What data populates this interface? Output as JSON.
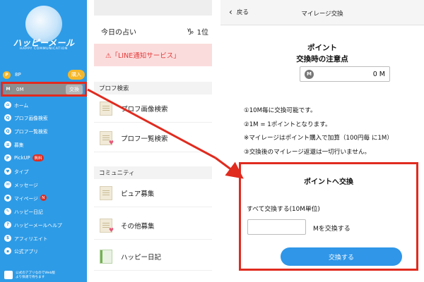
{
  "sidebar": {
    "logo_text": "ハッピーメール",
    "logo_sub": "HAPPY COMMUNICATION",
    "points": {
      "icon": "P",
      "value": "8P",
      "action": "購入"
    },
    "mileage": {
      "icon": "M",
      "value": "0M",
      "action": "交換"
    },
    "menu": [
      {
        "label": "ホーム",
        "icon": "home-icon",
        "glyph": "⌂"
      },
      {
        "label": "プロフ画像検索",
        "icon": "search-icon",
        "glyph": "Q"
      },
      {
        "label": "プロフ一覧検索",
        "icon": "search-icon",
        "glyph": "Q"
      },
      {
        "label": "募集",
        "icon": "list-icon",
        "glyph": "≡"
      },
      {
        "label": "PickUP",
        "icon": "pickup-icon",
        "glyph": "P",
        "badge": "無料"
      },
      {
        "label": "タイプ",
        "icon": "heart-icon",
        "glyph": "♥"
      },
      {
        "label": "メッセージ",
        "icon": "message-icon",
        "glyph": "✉"
      },
      {
        "label": "マイページ",
        "icon": "user-icon",
        "glyph": "●",
        "badge_round": "N"
      },
      {
        "label": "ハッピー日記",
        "icon": "diary-icon",
        "glyph": "✎"
      },
      {
        "label": "ハッピーメールヘルプ",
        "icon": "help-icon",
        "glyph": "?"
      },
      {
        "label": "アフィリエイト",
        "icon": "dollar-icon",
        "glyph": "$"
      },
      {
        "label": "公式アプリ",
        "icon": "app-icon",
        "glyph": "▪"
      }
    ],
    "footer_line1": "公式のアプリなのでWeb版",
    "footer_line2": "より快適で待ちます"
  },
  "middle": {
    "fortune_label": "今日の占い",
    "fortune_sign": "♑",
    "fortune_rank": "1位",
    "banner": "⚠「LINE通知サービス」",
    "section_profile": "プロフ検索",
    "item_prof_image": "プロフ画像検索",
    "item_prof_list": "プロフ一覧検索",
    "section_community": "コミュニティ",
    "item_pure": "ピュア募集",
    "item_other": "その他募集",
    "item_diary": "ハッピー日記"
  },
  "right": {
    "back_label": "戻る",
    "title": "マイレージ交換",
    "notice_line1": "ポイント",
    "notice_line2": "交換時の注意点",
    "balance_icon": "M",
    "balance_value": "0 M",
    "rules": [
      "①10M毎に交換可能です。",
      "②1M = 1ポイントとなります。",
      "※マイレージはポイント購入で加算（100円毎 に1M）",
      "③交換後のマイレージ返還は一切行いません。"
    ],
    "card_title": "ポイントへ交換",
    "card_unit_text": "すべて交換する(10M単位)",
    "amount_value": "",
    "amount_suffix": "Mを交換する",
    "exchange_button": "交換する"
  },
  "colors": {
    "sidebar_blue": "#2e9be6",
    "highlight_red": "#e02b1f",
    "button_blue": "#2f96e8",
    "banner_pink": "#fbdcdc"
  }
}
